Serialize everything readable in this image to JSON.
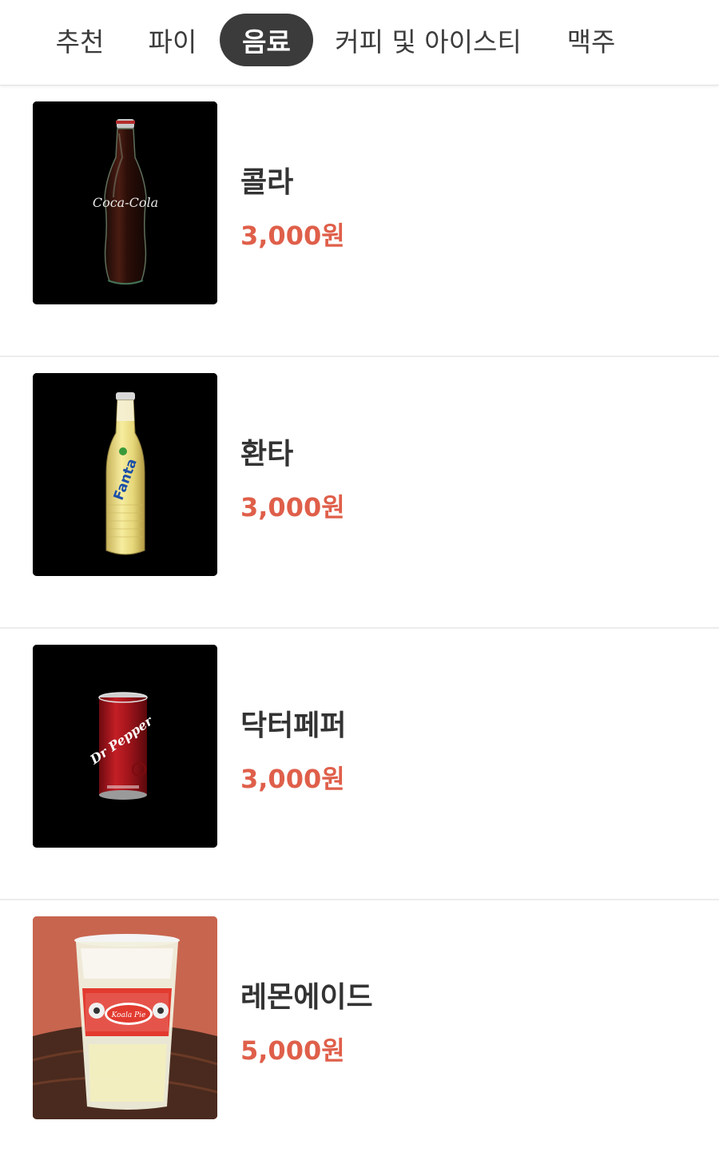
{
  "tabs": [
    {
      "label": "추천"
    },
    {
      "label": "파이"
    },
    {
      "label": "음료"
    },
    {
      "label": "커피 및 아이스티"
    },
    {
      "label": "맥주"
    }
  ],
  "active_tab": "음료",
  "items": [
    {
      "name": "콜라",
      "price": "3,000원",
      "image": "cola-bottle",
      "brand_text": "Coca-Cola"
    },
    {
      "name": "환타",
      "price": "3,000원",
      "image": "fanta-bottle",
      "brand_text": "Fanta"
    },
    {
      "name": "닥터페퍼",
      "price": "3,000원",
      "image": "dr-pepper-can",
      "brand_text": "Dr Pepper"
    },
    {
      "name": "레몬에이드",
      "price": "5,000원",
      "image": "lemonade-cup",
      "brand_text": "Koala Pie"
    }
  ],
  "colors": {
    "price": "#df5f4a",
    "active_tab_bg": "#3b3b3b",
    "text": "#333333"
  }
}
